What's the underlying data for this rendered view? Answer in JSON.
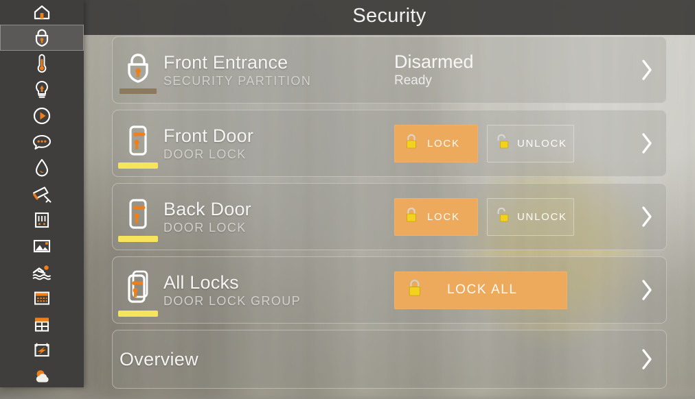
{
  "header": {
    "title": "Security"
  },
  "colors": {
    "accent_orange": "#eda95c",
    "icon_orange": "#ee7f1a",
    "lock_yellow": "#f2d21e",
    "rail_bg": "#3f3e3c",
    "rail_selected": "#5a5957",
    "status_tan": "#8c7a5e",
    "status_yellow": "#f7e45c"
  },
  "sidebar": {
    "items": [
      {
        "name": "home",
        "icon": "home-icon",
        "selected": false
      },
      {
        "name": "security",
        "icon": "lock-shield-icon",
        "selected": true
      },
      {
        "name": "climate",
        "icon": "thermometer-icon",
        "selected": false
      },
      {
        "name": "lighting",
        "icon": "lightbulb-icon",
        "selected": false
      },
      {
        "name": "media",
        "icon": "play-circle-icon",
        "selected": false
      },
      {
        "name": "messages",
        "icon": "chat-bubble-icon",
        "selected": false
      },
      {
        "name": "water",
        "icon": "water-drop-icon",
        "selected": false
      },
      {
        "name": "cameras",
        "icon": "cctv-camera-icon",
        "selected": false
      },
      {
        "name": "shades",
        "icon": "blinds-icon",
        "selected": false
      },
      {
        "name": "images",
        "icon": "picture-icon",
        "selected": false
      },
      {
        "name": "pool",
        "icon": "swimmer-icon",
        "selected": false
      },
      {
        "name": "calendar",
        "icon": "calendar-icon",
        "selected": false
      },
      {
        "name": "windows",
        "icon": "window-awning-icon",
        "selected": false
      },
      {
        "name": "energy",
        "icon": "energy-bolt-icon",
        "selected": false
      },
      {
        "name": "weather",
        "icon": "sun-cloud-icon",
        "selected": false
      }
    ]
  },
  "cards": [
    {
      "id": "front-entrance",
      "icon": "lock-shield-icon",
      "title": "Front Entrance",
      "subtitle": "SECURITY PARTITION",
      "status_main": "Disarmed",
      "status_sub": "Ready",
      "statusbar_color": "#8c7a5e",
      "chevron": "chevron-right-icon"
    },
    {
      "id": "front-door",
      "icon": "door-lock-icon",
      "title": "Front Door",
      "subtitle": "DOOR LOCK",
      "statusbar_color": "#f7e45c",
      "buttons": [
        {
          "id": "lock",
          "label": "LOCK",
          "icon": "padlock-closed-icon",
          "style": "filled"
        },
        {
          "id": "unlock",
          "label": "UNLOCK",
          "icon": "padlock-open-icon",
          "style": "outline"
        }
      ],
      "chevron": "chevron-right-icon"
    },
    {
      "id": "back-door",
      "icon": "door-lock-icon",
      "title": "Back Door",
      "subtitle": "DOOR LOCK",
      "statusbar_color": "#f7e45c",
      "buttons": [
        {
          "id": "lock",
          "label": "LOCK",
          "icon": "padlock-closed-icon",
          "style": "filled"
        },
        {
          "id": "unlock",
          "label": "UNLOCK",
          "icon": "padlock-open-icon",
          "style": "outline"
        }
      ],
      "chevron": "chevron-right-icon"
    },
    {
      "id": "all-locks",
      "icon": "door-lock-group-icon",
      "title": "All Locks",
      "subtitle": "DOOR LOCK GROUP",
      "statusbar_color": "#f7e45c",
      "buttons": [
        {
          "id": "lock-all",
          "label": "LOCK ALL",
          "icon": "padlock-closed-icon",
          "style": "filled-wide"
        }
      ],
      "chevron": "chevron-right-icon"
    },
    {
      "id": "overview",
      "title": "Overview",
      "chevron": "chevron-right-icon"
    }
  ]
}
